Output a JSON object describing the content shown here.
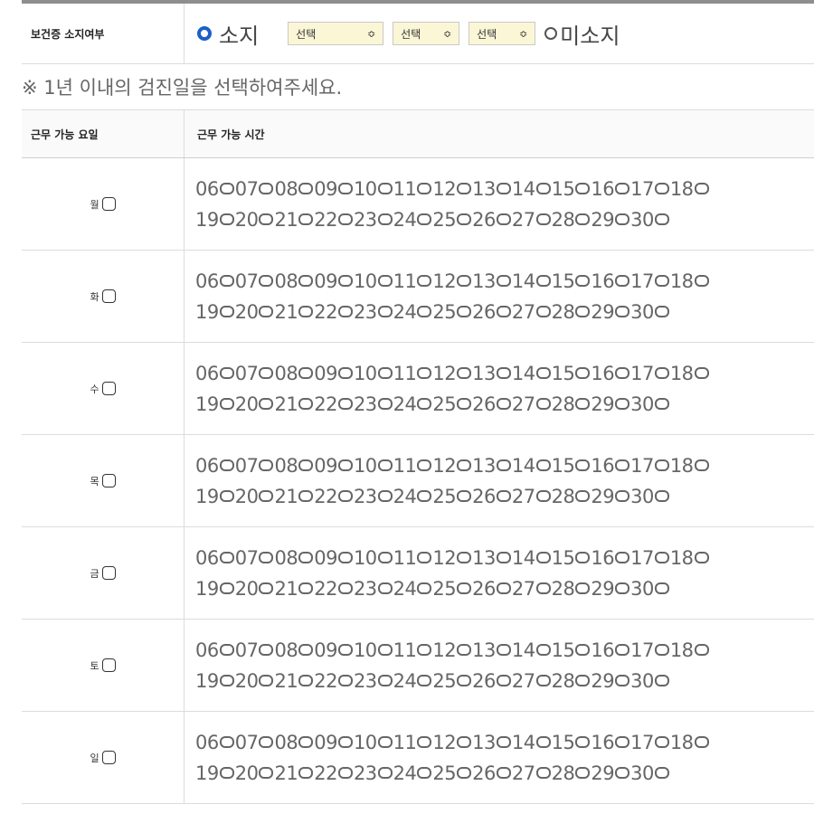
{
  "health_cert": {
    "label": "보건증 소지여부",
    "has_label": "소지",
    "selects": [
      "선택",
      "선택",
      "선택"
    ],
    "select_arrow": "≎",
    "not_has_label": "미소지"
  },
  "note": "※ 1년 이내의 검진일을 선택하여주세요.",
  "schedule": {
    "day_header": "근무 가능 요일",
    "time_header": "근무 가능 시간",
    "days": [
      "월",
      "화",
      "수",
      "목",
      "금",
      "토",
      "일"
    ],
    "hours_row1": [
      "06",
      "07",
      "08",
      "09",
      "10",
      "11",
      "12",
      "13",
      "14",
      "15",
      "16",
      "17",
      "18"
    ],
    "hours_row2": [
      "19",
      "20",
      "21",
      "22",
      "23",
      "24",
      "25",
      "26",
      "27",
      "28",
      "29",
      "30"
    ]
  }
}
